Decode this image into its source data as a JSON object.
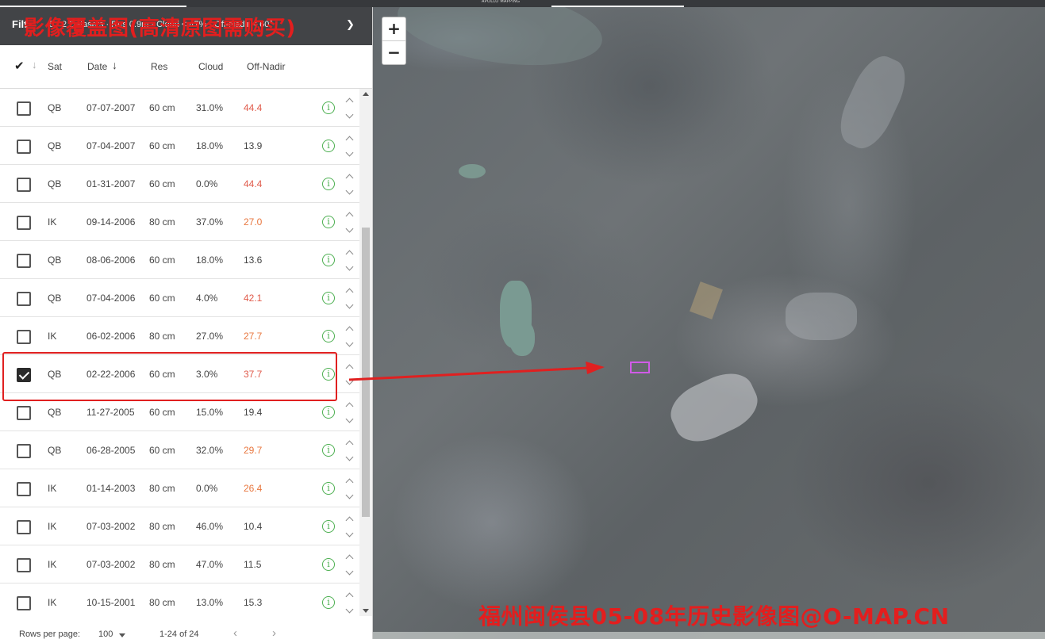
{
  "topbar": {
    "brand": "APOLLO MAPPING"
  },
  "filter": {
    "label": "Filt",
    "summary": "5 · 2 Datasets · Res 0.9m · Cloud < 47% · Off-Nadir < 60°",
    "watermark": "影像覆盖图(高清原图需购买)"
  },
  "table": {
    "headers": {
      "sat": "Sat",
      "date": "Date",
      "res": "Res",
      "cloud": "Cloud",
      "nadir": "Off-Nadir"
    },
    "rows": [
      {
        "sat": "QB",
        "date": "07-07-2007",
        "res": "60 cm",
        "cloud": "31.0%",
        "nadir": "44.4",
        "nadir_color": "#e05a4a",
        "checked": false
      },
      {
        "sat": "QB",
        "date": "07-04-2007",
        "res": "60 cm",
        "cloud": "18.0%",
        "nadir": "13.9",
        "nadir_color": "#444444",
        "checked": false
      },
      {
        "sat": "QB",
        "date": "01-31-2007",
        "res": "60 cm",
        "cloud": "0.0%",
        "nadir": "44.4",
        "nadir_color": "#e05a4a",
        "checked": false
      },
      {
        "sat": "IK",
        "date": "09-14-2006",
        "res": "80 cm",
        "cloud": "37.0%",
        "nadir": "27.0",
        "nadir_color": "#e8773f",
        "checked": false
      },
      {
        "sat": "QB",
        "date": "08-06-2006",
        "res": "60 cm",
        "cloud": "18.0%",
        "nadir": "13.6",
        "nadir_color": "#444444",
        "checked": false
      },
      {
        "sat": "QB",
        "date": "07-04-2006",
        "res": "60 cm",
        "cloud": "4.0%",
        "nadir": "42.1",
        "nadir_color": "#e05a4a",
        "checked": false
      },
      {
        "sat": "IK",
        "date": "06-02-2006",
        "res": "80 cm",
        "cloud": "27.0%",
        "nadir": "27.7",
        "nadir_color": "#e8773f",
        "checked": false
      },
      {
        "sat": "QB",
        "date": "02-22-2006",
        "res": "60 cm",
        "cloud": "3.0%",
        "nadir": "37.7",
        "nadir_color": "#e05a4a",
        "checked": true
      },
      {
        "sat": "QB",
        "date": "11-27-2005",
        "res": "60 cm",
        "cloud": "15.0%",
        "nadir": "19.4",
        "nadir_color": "#444444",
        "checked": false
      },
      {
        "sat": "QB",
        "date": "06-28-2005",
        "res": "60 cm",
        "cloud": "32.0%",
        "nadir": "29.7",
        "nadir_color": "#e8773f",
        "checked": false
      },
      {
        "sat": "IK",
        "date": "01-14-2003",
        "res": "80 cm",
        "cloud": "0.0%",
        "nadir": "26.4",
        "nadir_color": "#e8773f",
        "checked": false
      },
      {
        "sat": "IK",
        "date": "07-03-2002",
        "res": "80 cm",
        "cloud": "46.0%",
        "nadir": "10.4",
        "nadir_color": "#444444",
        "checked": false
      },
      {
        "sat": "IK",
        "date": "07-03-2002",
        "res": "80 cm",
        "cloud": "47.0%",
        "nadir": "11.5",
        "nadir_color": "#444444",
        "checked": false
      },
      {
        "sat": "IK",
        "date": "10-15-2001",
        "res": "80 cm",
        "cloud": "13.0%",
        "nadir": "15.3",
        "nadir_color": "#444444",
        "checked": false
      }
    ]
  },
  "pager": {
    "rows_label": "Rows per page:",
    "rows_value": "100",
    "range": "1-24 of 24",
    "prev": "‹",
    "next": "›"
  },
  "map": {
    "zoom_in": "+",
    "zoom_out": "−",
    "watermark": "福州闽侯县05-08年历史影像图@O-MAP.CN",
    "footprint_color": "#d15be8"
  },
  "annotation": {
    "color": "#e02020"
  }
}
